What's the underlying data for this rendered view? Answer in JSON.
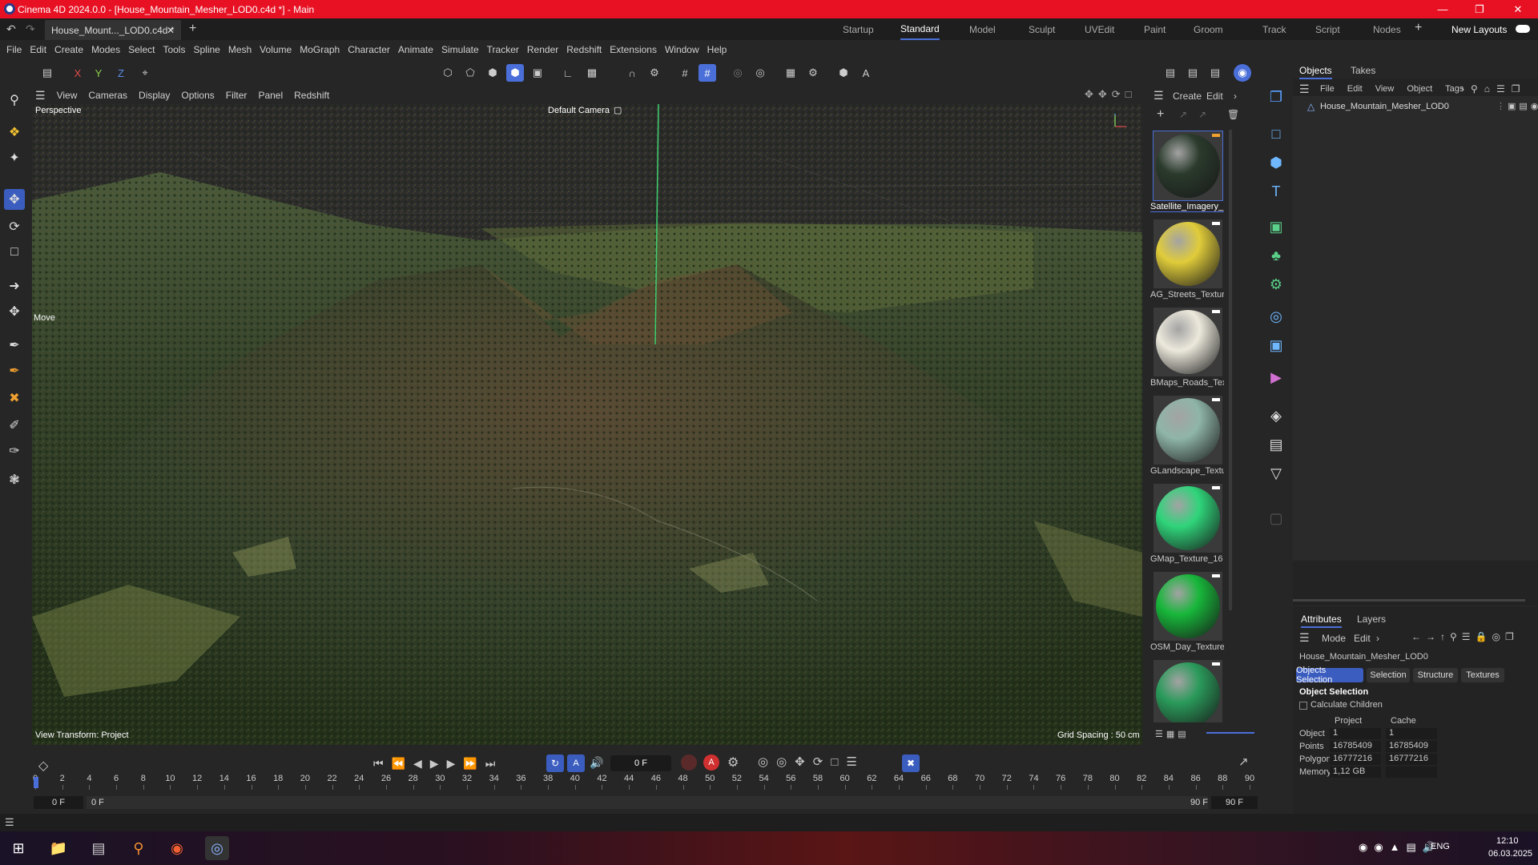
{
  "window": {
    "title": "Cinema 4D 2024.0.0 - [House_Mountain_Mesher_LOD0.c4d *] - Main"
  },
  "doc_tab": {
    "label": "House_Mount..._LOD0.c4d *"
  },
  "layouts": {
    "items": [
      "Startup",
      "Standard",
      "Model",
      "Sculpt",
      "UVEdit",
      "Paint",
      "Groom",
      "Track",
      "Script",
      "Nodes"
    ],
    "active": "Standard",
    "new_layouts": "New Layouts"
  },
  "menu": [
    "File",
    "Edit",
    "Create",
    "Modes",
    "Select",
    "Tools",
    "Spline",
    "Mesh",
    "Volume",
    "MoGraph",
    "Character",
    "Animate",
    "Simulate",
    "Tracker",
    "Render",
    "Redshift",
    "Extensions",
    "Window",
    "Help"
  ],
  "axes": {
    "x": "X",
    "y": "Y",
    "z": "Z"
  },
  "viewport_menu": [
    "View",
    "Cameras",
    "Display",
    "Options",
    "Filter",
    "Panel",
    "Redshift"
  ],
  "viewport": {
    "name": "Perspective",
    "camera": "Default Camera",
    "tool": "Move",
    "view_transform": "View Transform: Project",
    "grid_spacing": "Grid Spacing : 50 cm"
  },
  "material_menu": [
    "Create",
    "Edit"
  ],
  "materials": [
    {
      "name": "Satellite_Imagery_",
      "color": "#2a3a2c"
    },
    {
      "name": "AG_Streets_Textur",
      "color": "#e0cc3a"
    },
    {
      "name": "BMaps_Roads_Tex",
      "color": "#ece9dc"
    },
    {
      "name": "GLandscape_Textu",
      "color": "#8fb5a8"
    },
    {
      "name": "GMap_Texture_16",
      "color": "#2fd47a"
    },
    {
      "name": "OSM_Day_Texture",
      "color": "#17b63a"
    },
    {
      "name": "",
      "color": "#2a9a5a"
    }
  ],
  "objects_panel": {
    "tabs": [
      "Objects",
      "Takes"
    ],
    "menu": [
      "File",
      "Edit",
      "View",
      "Object",
      "Tags"
    ],
    "items": [
      "House_Mountain_Mesher_LOD0"
    ]
  },
  "attributes_panel": {
    "tabs": [
      "Attributes",
      "Layers"
    ],
    "menu": [
      "Mode",
      "Edit"
    ],
    "object_name": "House_Mountain_Mesher_LOD0",
    "sub_tabs": [
      "Objects Selection",
      "Selection",
      "Structure",
      "Textures"
    ],
    "section_title": "Object Selection",
    "checkbox_label": "Calculate Children",
    "table_headers": [
      "",
      "Project",
      "Cache"
    ],
    "rows": [
      {
        "label": "Object",
        "project": "1",
        "cache": "1"
      },
      {
        "label": "Points",
        "project": "16785409",
        "cache": "16785409"
      },
      {
        "label": "Polygons",
        "project": "16777216",
        "cache": "16777216"
      },
      {
        "label": "Memory",
        "project": "1,12 GB",
        "cache": ""
      }
    ]
  },
  "timeline": {
    "current_frame": "0 F",
    "start_field": "0 F",
    "start_field2": "0 F",
    "end_field": "90 F",
    "end_field2": "90 F",
    "ticks": [
      "0",
      "2",
      "4",
      "6",
      "8",
      "10",
      "12",
      "14",
      "16",
      "18",
      "20",
      "22",
      "24",
      "26",
      "28",
      "30",
      "32",
      "34",
      "36",
      "38",
      "40",
      "42",
      "44",
      "46",
      "48",
      "50",
      "52",
      "54",
      "56",
      "58",
      "60",
      "62",
      "64",
      "66",
      "68",
      "70",
      "72",
      "74",
      "76",
      "78",
      "80",
      "82",
      "84",
      "86",
      "88",
      "90"
    ]
  },
  "taskbar": {
    "lang": "ENG",
    "time": "12:10",
    "date": "06.03.2025"
  },
  "colors": {
    "accent": "#3b5dbf",
    "titlebar": "#e81123",
    "panel": "#262626"
  }
}
